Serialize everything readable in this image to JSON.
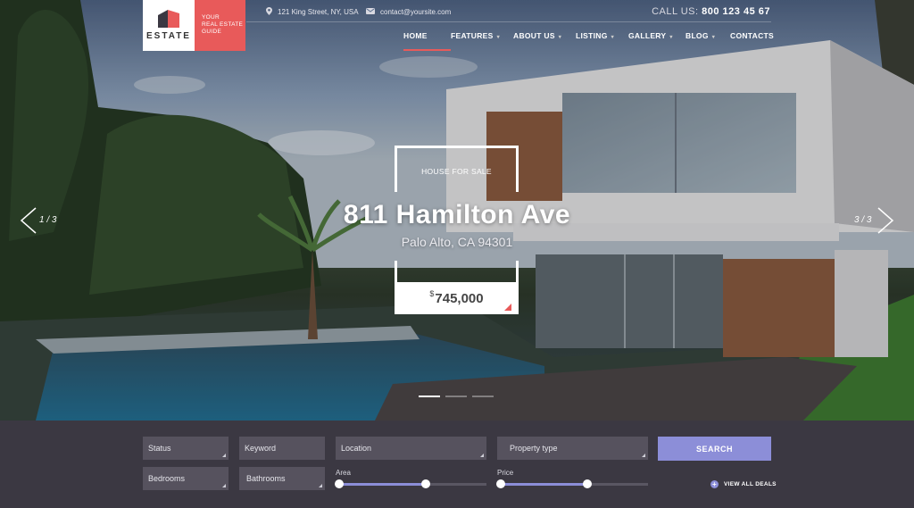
{
  "brand": {
    "logo_name": "ESTATE",
    "tagline_line1": "YOUR",
    "tagline_line2": "REAL ESTATE",
    "tagline_line3": "GUIDE"
  },
  "topbar": {
    "address": "121 King Street, NY, USA",
    "email": "contact@yoursite.com",
    "call_label": "CALL US:",
    "phone": "800 123 45 67",
    "address_icon": "location-pin-icon",
    "email_icon": "envelope-icon"
  },
  "nav": {
    "items": [
      {
        "label": "HOME",
        "active": true,
        "dropdown": false
      },
      {
        "label": "FEATURES",
        "active": false,
        "dropdown": true
      },
      {
        "label": "ABOUT US",
        "active": false,
        "dropdown": true
      },
      {
        "label": "LISTING",
        "active": false,
        "dropdown": true
      },
      {
        "label": "GALLERY",
        "active": false,
        "dropdown": true
      },
      {
        "label": "BLOG",
        "active": false,
        "dropdown": true
      },
      {
        "label": "CONTACTS",
        "active": false,
        "dropdown": false
      }
    ]
  },
  "slide": {
    "badge": "HOUSE FOR SALE",
    "title": "811 Hamilton Ave",
    "location": "Palo Alto, CA 94301",
    "currency": "$",
    "price": "745,000",
    "prev_count": "1 / 3",
    "next_count": "3 / 3",
    "total_slides": 3,
    "current_slide": 1
  },
  "search": {
    "status": "Status",
    "keyword": "Keyword",
    "location": "Location",
    "property_type": "Property type",
    "bedrooms": "Bedrooms",
    "bathrooms": "Bathrooms",
    "area_label": "Area",
    "price_label": "Price",
    "search_button": "SEARCH",
    "view_all": "VIEW ALL DEALS",
    "area_range": [
      0,
      0.59
    ],
    "price_range": [
      0,
      0.59
    ]
  },
  "colors": {
    "accent": "#e85a5a",
    "button": "#8c8ed8",
    "panel": "#3b3842",
    "field": "#56525e"
  }
}
